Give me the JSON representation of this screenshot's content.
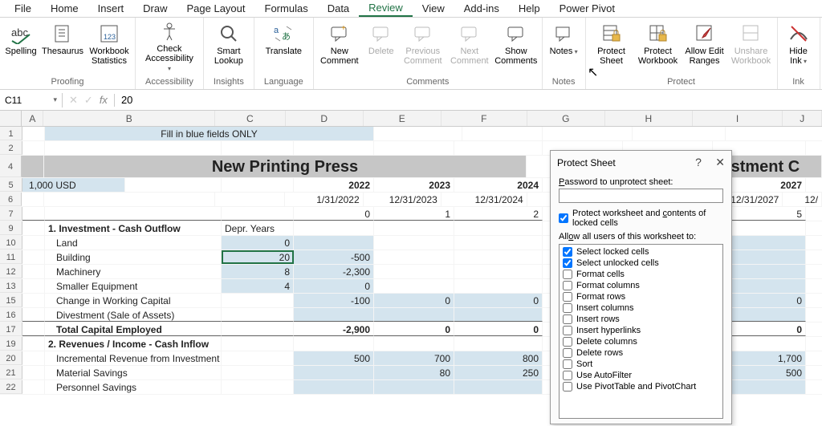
{
  "tabs": [
    "File",
    "Home",
    "Insert",
    "Draw",
    "Page Layout",
    "Formulas",
    "Data",
    "Review",
    "View",
    "Add-ins",
    "Help",
    "Power Pivot"
  ],
  "active_tab": "Review",
  "ribbon": {
    "proofing": {
      "label": "Proofing",
      "spelling": "Spelling",
      "thesaurus": "Thesaurus",
      "workbook_stats": "Workbook\nStatistics"
    },
    "accessibility": {
      "label": "Accessibility",
      "check": "Check\nAccessibility"
    },
    "insights": {
      "label": "Insights",
      "smart_lookup": "Smart\nLookup"
    },
    "language": {
      "label": "Language",
      "translate": "Translate"
    },
    "comments": {
      "label": "Comments",
      "new": "New\nComment",
      "delete": "Delete",
      "previous": "Previous\nComment",
      "next": "Next\nComment",
      "show": "Show\nComments"
    },
    "notes": {
      "label": "Notes",
      "notes": "Notes"
    },
    "protect": {
      "label": "Protect",
      "sheet": "Protect\nSheet",
      "workbook": "Protect\nWorkbook",
      "allow_edit": "Allow Edit\nRanges",
      "unshare": "Unshare\nWorkbook"
    },
    "ink": {
      "label": "Ink",
      "hide_ink": "Hide\nInk"
    }
  },
  "formula_bar": {
    "name_box": "C11",
    "fx_label": "fx",
    "value": "20"
  },
  "columns": [
    "A",
    "B",
    "C",
    "D",
    "E",
    "F",
    "G",
    "H",
    "I",
    "J"
  ],
  "sheet": {
    "row1_hint": "Fill in blue fields ONLY",
    "row4_title": "New Printing Press",
    "row4_title2": "Investment C",
    "row5_a": "1,000 USD",
    "row5_d": "2022",
    "row5_e": "2023",
    "row5_f": "2024",
    "row5_i": "2027",
    "row6_d": "1/31/2022",
    "row6_e": "12/31/2023",
    "row6_f": "12/31/2024",
    "row6_i": "12/31/2027",
    "row6_j": "12/",
    "row7_d": "0",
    "row7_e": "1",
    "row7_f": "2",
    "row7_i": "5",
    "row9_b": "1.  Investment - Cash Outflow",
    "row9_c": "Depr. Years",
    "row10_b": "Land",
    "row10_c": "0",
    "row11_b": "Building",
    "row11_c": "20",
    "row11_d": "-500",
    "row12_b": "Machinery",
    "row12_c": "8",
    "row12_d": "-2,300",
    "row13_b": "Smaller Equipment",
    "row13_c": "4",
    "row13_d": "0",
    "row15_b": "Change in Working Capital",
    "row15_d": "-100",
    "row15_e": "0",
    "row15_f": "0",
    "row15_i": "0",
    "row16_b": "Divestment (Sale of Assets)",
    "row17_b": "Total Capital Employed",
    "row17_d": "-2,900",
    "row17_e": "0",
    "row17_f": "0",
    "row17_i": "0",
    "row19_b": "2. Revenues / Income - Cash Inflow",
    "row20_b": "Incremental Revenue from Investment",
    "row20_d": "500",
    "row20_e": "700",
    "row20_f": "800",
    "row20_i": "1,700",
    "row21_b": "Material Savings",
    "row21_e": "80",
    "row21_f": "250",
    "row21_i": "500",
    "row22_b": "Personnel Savings"
  },
  "dialog": {
    "title": "Protect Sheet",
    "pwd_label": "Password to unprotect sheet:",
    "protect_contents": "Protect worksheet and contents of locked cells",
    "allow_label": "Allow all users of this worksheet to:",
    "perms": [
      {
        "label": "Select locked cells",
        "checked": true,
        "underline": "l"
      },
      {
        "label": "Select unlocked cells",
        "checked": true,
        "underline": "u"
      },
      {
        "label": "Format cells",
        "checked": false
      },
      {
        "label": "Format columns",
        "checked": false
      },
      {
        "label": "Format rows",
        "checked": false
      },
      {
        "label": "Insert columns",
        "checked": false
      },
      {
        "label": "Insert rows",
        "checked": false
      },
      {
        "label": "Insert hyperlinks",
        "checked": false
      },
      {
        "label": "Delete columns",
        "checked": false
      },
      {
        "label": "Delete rows",
        "checked": false
      },
      {
        "label": "Sort",
        "checked": false
      },
      {
        "label": "Use AutoFilter",
        "checked": false
      },
      {
        "label": "Use PivotTable and PivotChart",
        "checked": false
      }
    ]
  }
}
